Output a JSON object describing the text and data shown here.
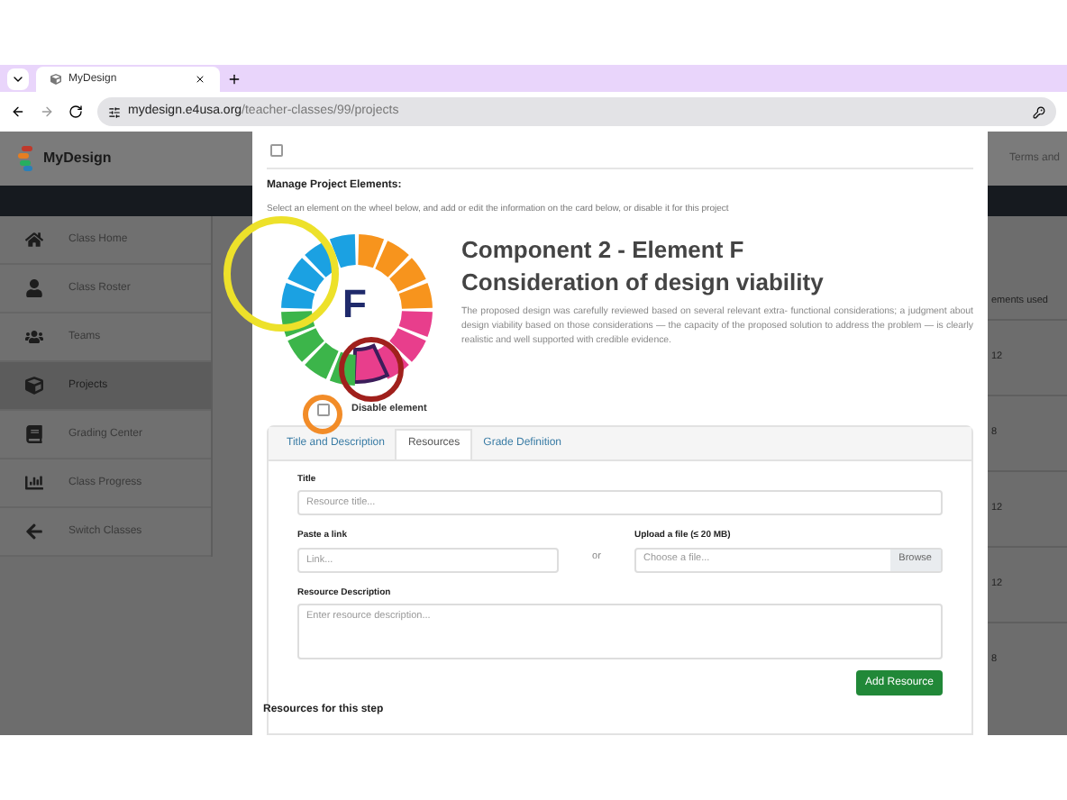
{
  "browser": {
    "tab_title": "MyDesign",
    "url_host": "mydesign.e4usa.org",
    "url_path": "/teacher-classes/99/projects"
  },
  "app": {
    "logo_text": "MyDesign",
    "header_right": "Terms and",
    "sidebar": [
      {
        "label": "Class Home",
        "selected": false
      },
      {
        "label": "Class Roster",
        "selected": false
      },
      {
        "label": "Teams",
        "selected": false
      },
      {
        "label": "Projects",
        "selected": true
      },
      {
        "label": "Grading Center",
        "selected": false
      },
      {
        "label": "Class Progress",
        "selected": false
      },
      {
        "label": "Switch Classes",
        "selected": false
      }
    ],
    "table_header": "ements used",
    "table_values": [
      "12",
      "8",
      "12",
      "12",
      "8"
    ]
  },
  "modal": {
    "top_checkbox": {
      "checked": false
    },
    "heading": "Manage Project Elements:",
    "instruction": "Select an element on the wheel below, and add or edit the information on the card below, or disable it for this project",
    "wheel": {
      "center_label": "F",
      "segments": [
        {
          "color": "#f7941d",
          "selected": false
        },
        {
          "color": "#f7941d",
          "selected": false
        },
        {
          "color": "#f7941d",
          "selected": false
        },
        {
          "color": "#f7941d",
          "selected": false
        },
        {
          "color": "#e83e8c",
          "selected": false
        },
        {
          "color": "#e83e8c",
          "selected": false
        },
        {
          "color": "#e83e8c",
          "selected": false
        },
        {
          "color": "#e83e8c",
          "selected": true
        },
        {
          "color": "#3cb54a",
          "selected": false
        },
        {
          "color": "#3cb54a",
          "selected": false
        },
        {
          "color": "#3cb54a",
          "selected": false
        },
        {
          "color": "#3cb54a",
          "selected": false
        },
        {
          "color": "#1ba1e2",
          "selected": false
        },
        {
          "color": "#1ba1e2",
          "selected": false
        },
        {
          "color": "#1ba1e2",
          "selected": false
        },
        {
          "color": "#1ba1e2",
          "selected": false
        }
      ]
    },
    "element_title": "Component 2 - Element F",
    "element_subtitle": "Consideration of design viability",
    "element_description": "The proposed design was carefully reviewed based on several relevant extra- functional considerations; a judgment about design viability based on those considerations — the capacity of the proposed solution to address the problem — is clearly realistic and well supported with credible evidence.",
    "disable": {
      "label": "Disable element",
      "checked": false
    },
    "tabs": [
      {
        "label": "Title and Description",
        "selected": false
      },
      {
        "label": "Resources",
        "selected": true
      },
      {
        "label": "Grade Definition",
        "selected": false
      }
    ],
    "form": {
      "title_label": "Title",
      "title_placeholder": "Resource title...",
      "link_label": "Paste a link",
      "link_placeholder": "Link...",
      "or_text": "or",
      "upload_label": "Upload a file (≤ 20 MB)",
      "upload_placeholder": "Choose a file...",
      "browse_button": "Browse",
      "description_label": "Resource Description",
      "description_placeholder": "Enter resource description...",
      "add_button": "Add Resource"
    },
    "resources_heading": "Resources for this step"
  },
  "annotations": [
    {
      "color": "#ede12a"
    },
    {
      "color": "#a0201c"
    },
    {
      "color": "#f28c28"
    }
  ]
}
